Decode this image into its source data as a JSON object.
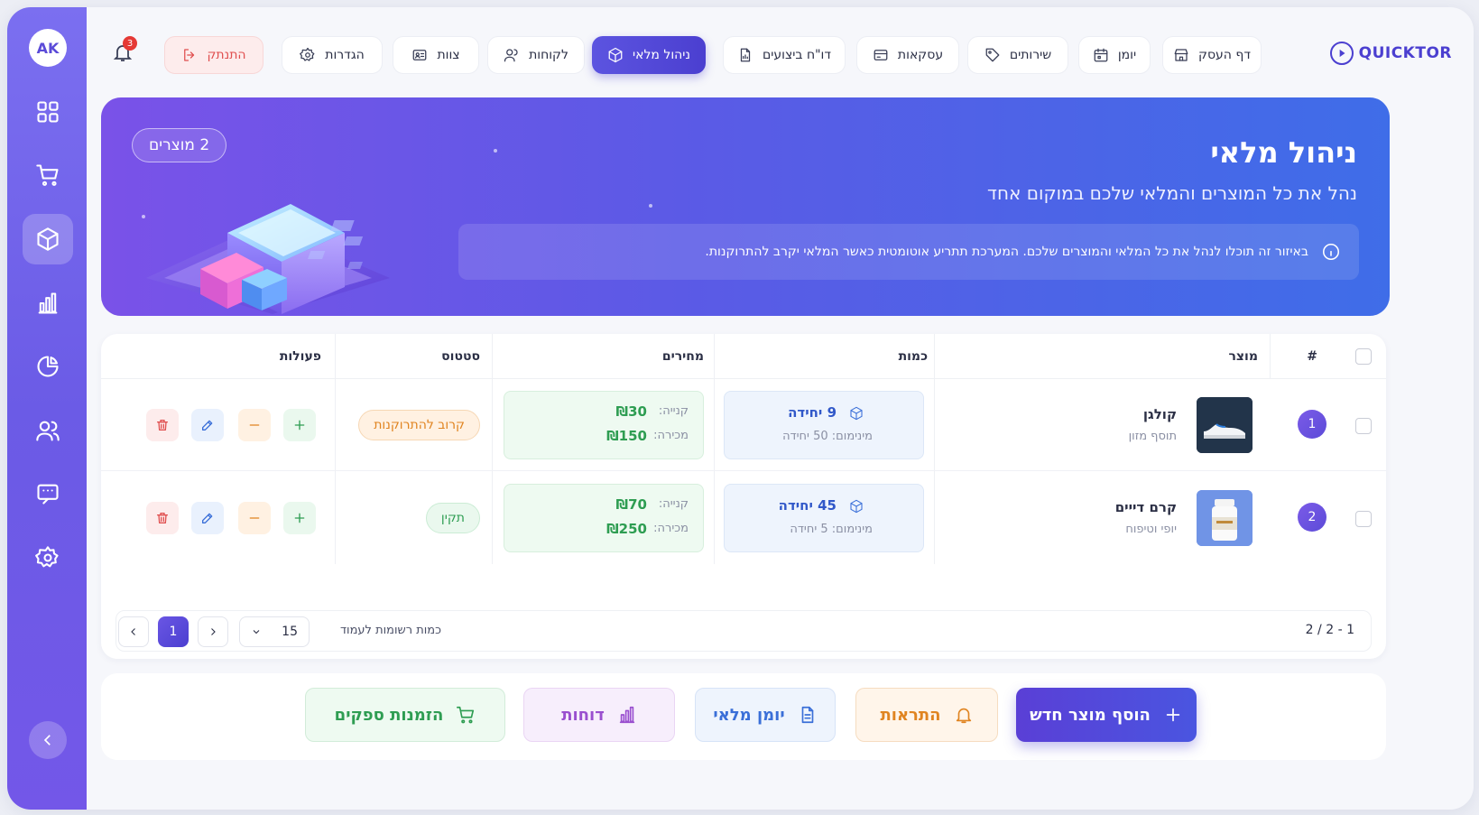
{
  "user": {
    "initials": "AK",
    "notifications": "3"
  },
  "brand": {
    "name": "QUICKTOR"
  },
  "nav": {
    "home": "דף העסק",
    "calendar": "יומן",
    "services": "שירותים",
    "deals": "עסקאות",
    "performance": "דו\"ח ביצועים",
    "inventory": "ניהול מלאי",
    "clients": "לקוחות",
    "team": "צוות",
    "settings": "הגדרות",
    "logout": "התנתק"
  },
  "hero": {
    "title": "ניהול מלאי",
    "subtitle": "נהל את כל המוצרים והמלאי שלכם במוקום אחד",
    "info": "באיזור זה תוכלו לנהל את כל המלאי והמוצרים שלכם. המערכת תתריע אוטומטית כאשר המלאי יקרב להתרוקנות.",
    "count": "2 מוצרים"
  },
  "table": {
    "headers": {
      "index": "#",
      "product": "מוצר",
      "quantity": "כמות",
      "prices": "מחירים",
      "status": "סטטוס",
      "actions": "פעולות"
    },
    "rows": [
      {
        "index": "1",
        "name": "קולגן",
        "category": "תוסף מזון",
        "qty": "9 יחידה",
        "min": "מינימום: 50 יחידה",
        "buy_label": "קנייה:",
        "buy": "₪30",
        "sell_label": "מכירה:",
        "sell": "₪150",
        "status": "קרוב להתרוקנות",
        "status_type": "warn"
      },
      {
        "index": "2",
        "name": "קרם דייים",
        "category": "יופי וטיפוח",
        "qty": "45 יחידה",
        "min": "מינימום: 5 יחידה",
        "buy_label": "קנייה:",
        "buy": "₪70",
        "sell_label": "מכירה:",
        "sell": "₪250",
        "status": "תקין",
        "status_type": "ok"
      }
    ]
  },
  "pager": {
    "range": "1 - 2 / 2",
    "per_page_label": "כמות רשומות לעמוד",
    "per_page": "15",
    "current": "1"
  },
  "actions": {
    "add": "הוסף מוצר חדש",
    "alerts": "התראות",
    "log": "יומן מלאי",
    "reports": "דוחות",
    "orders": "הזמנות ספקים"
  }
}
